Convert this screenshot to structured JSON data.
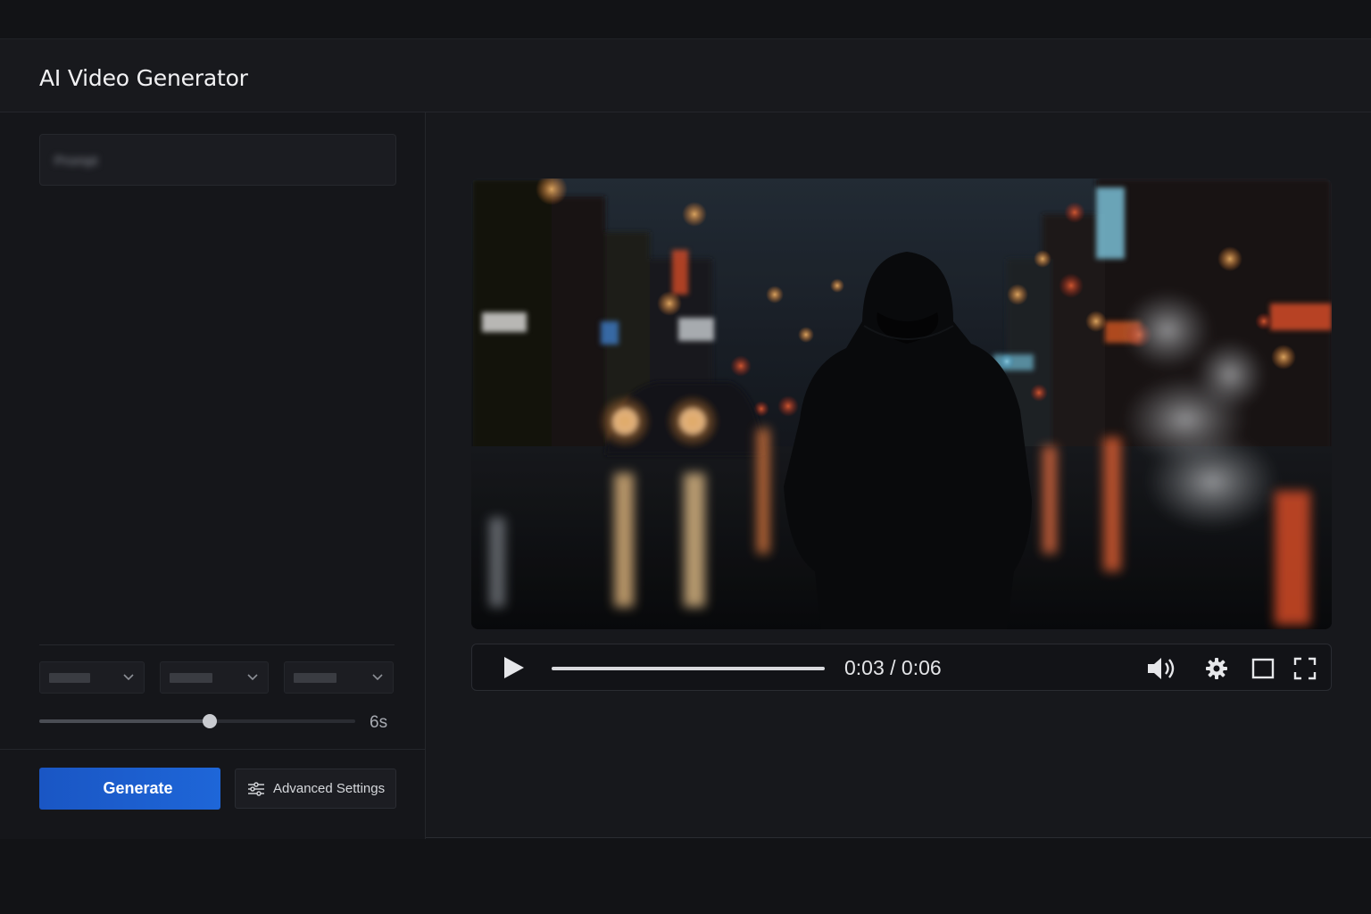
{
  "app": {
    "title": "AI Video Generator"
  },
  "sidebar": {
    "prompt": {
      "value": "Prompt",
      "blurred": true
    },
    "selects": [
      {
        "value": "",
        "icon": "chevron-down-icon"
      },
      {
        "value": "",
        "icon": "chevron-down-icon"
      },
      {
        "value": "",
        "icon": "chevron-down-icon"
      }
    ],
    "duration": {
      "value": 0.54,
      "label": "6s"
    },
    "generate_label": "Generate",
    "advanced_label": "Advanced Settings",
    "advanced_icon": "sliders-icon"
  },
  "player": {
    "time": "0:03 / 0:06",
    "progress": 1.0,
    "scene": "hooded figure walking on rainy neon city street at night",
    "icons": [
      "play-icon",
      "volume-icon",
      "gear-icon",
      "theater-mode-icon",
      "fullscreen-icon"
    ]
  },
  "colors": {
    "accent": "#1e66d8",
    "background": "#17181c"
  }
}
